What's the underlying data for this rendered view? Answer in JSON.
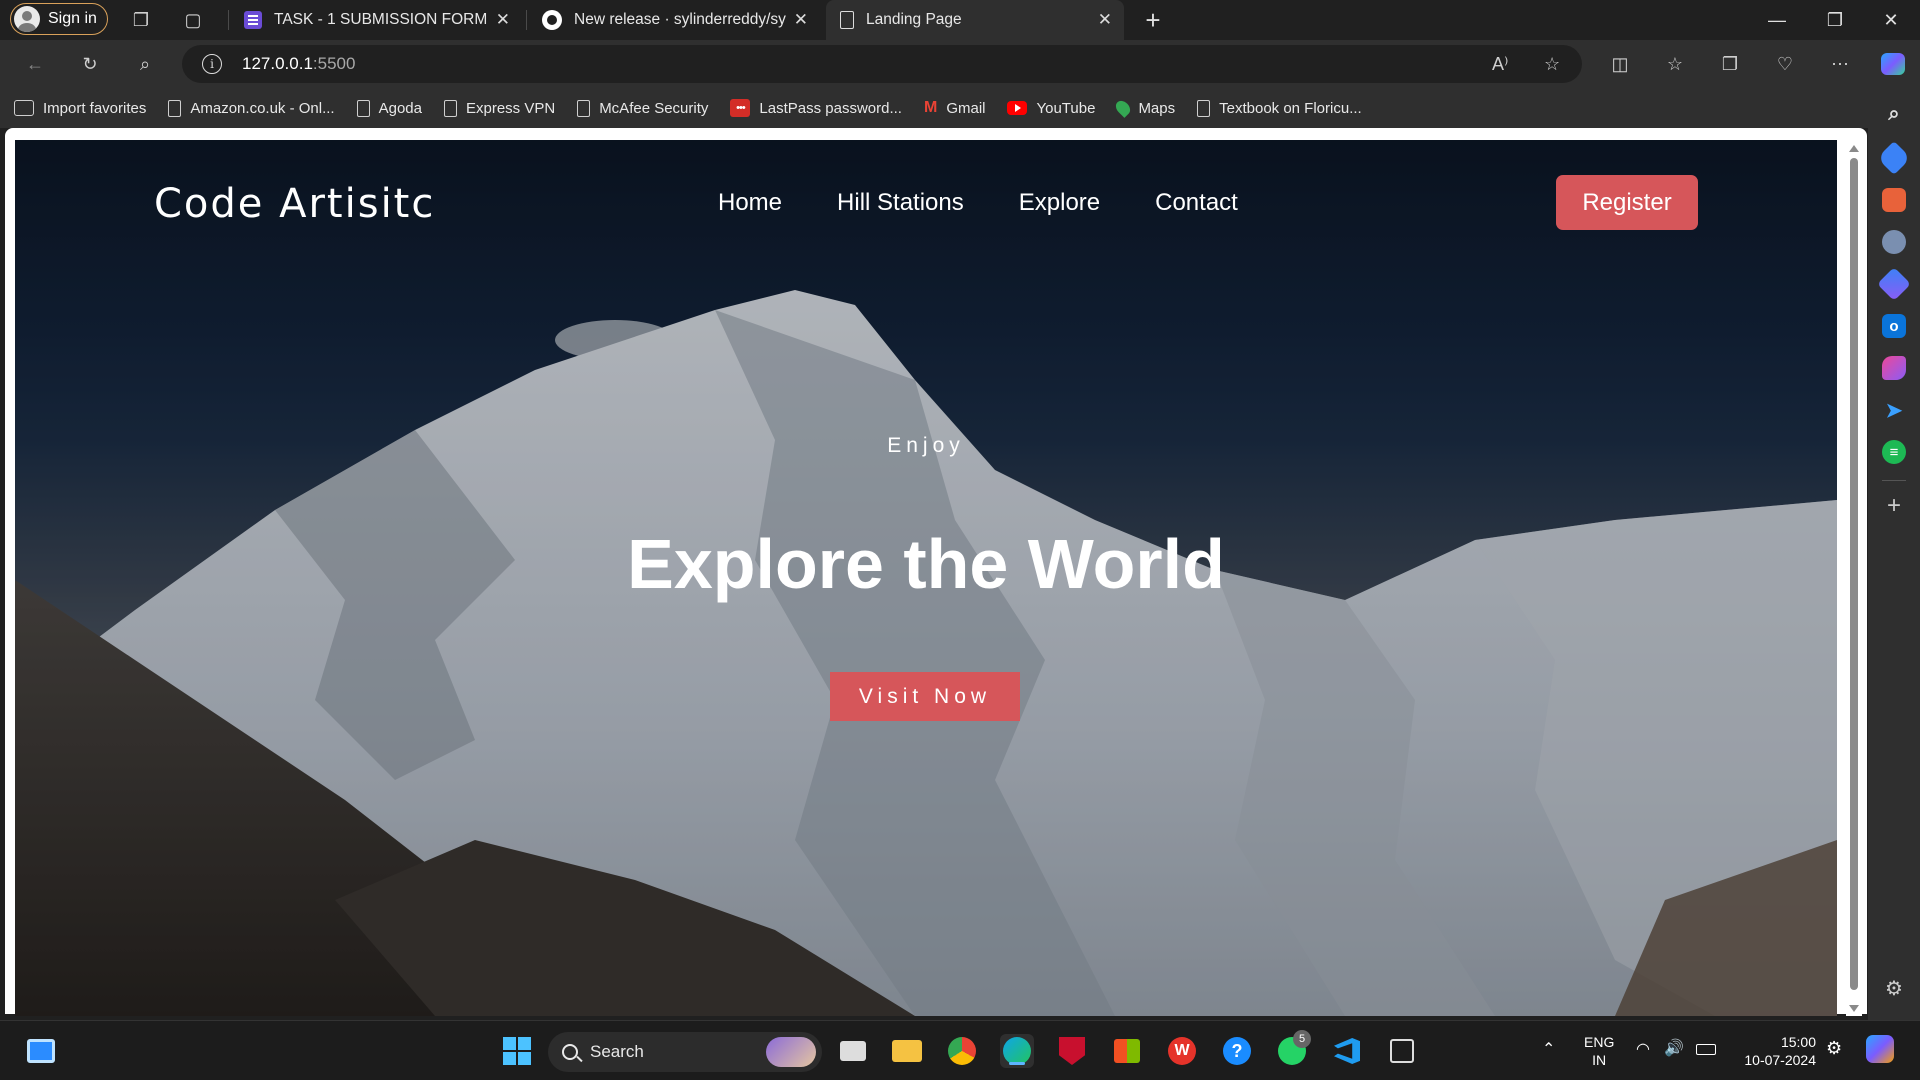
{
  "browser": {
    "sign_in_label": "Sign in",
    "tabs": [
      {
        "title": "TASK - 1 SUBMISSION FORM",
        "favicon": "form-icon"
      },
      {
        "title": "New release · sylinderreddy/sylin",
        "favicon": "github-icon"
      },
      {
        "title": "Landing Page",
        "favicon": "page-icon",
        "active": true
      }
    ],
    "new_tab_label": "+",
    "url_host": "127.0.0.1",
    "url_port": ":5500",
    "read_aloud_label": "A⁾"
  },
  "bookmarks": [
    {
      "label": "Import favorites",
      "icon": "import-icon"
    },
    {
      "label": "Amazon.co.uk - Onl...",
      "icon": "page-icon"
    },
    {
      "label": "Agoda",
      "icon": "page-icon"
    },
    {
      "label": "Express VPN",
      "icon": "page-icon"
    },
    {
      "label": "McAfee Security",
      "icon": "page-icon"
    },
    {
      "label": "LastPass password...",
      "icon": "lastpass-icon"
    },
    {
      "label": "Gmail",
      "icon": "gmail-icon"
    },
    {
      "label": "YouTube",
      "icon": "youtube-icon"
    },
    {
      "label": "Maps",
      "icon": "maps-icon"
    },
    {
      "label": "Textbook on Floricu...",
      "icon": "page-icon"
    }
  ],
  "site": {
    "logo": "Code Artisitc",
    "nav": [
      "Home",
      "Hill Stations",
      "Explore",
      "Contact"
    ],
    "register_label": "Register",
    "kicker": "Enjoy",
    "headline": "Explore the World",
    "cta_label": "Visit Now",
    "accent_color": "#d6565a"
  },
  "taskbar": {
    "search_placeholder": "Search",
    "lang_line1": "ENG",
    "lang_line2": "IN",
    "time": "15:00",
    "date": "10-07-2024",
    "whatsapp_badge": "5"
  }
}
